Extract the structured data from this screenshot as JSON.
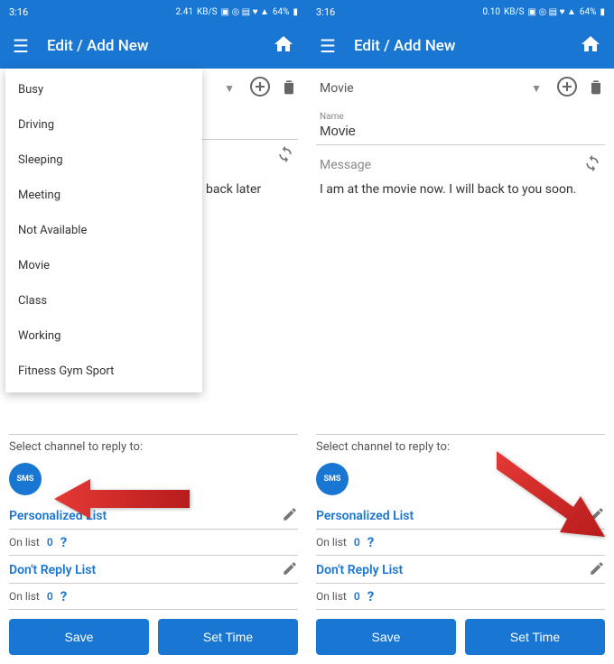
{
  "status": {
    "time": "3:16",
    "net_left": "2.41",
    "net_right": "0.10",
    "unit": "KB/S",
    "battery": "64%"
  },
  "app": {
    "title": "Edit / Add New"
  },
  "left": {
    "dropdown_items": [
      "Busy",
      "Driving",
      "Sleeping",
      "Meeting",
      "Not Available",
      "Movie",
      "Class",
      "Working",
      "Fitness Gym Sport"
    ],
    "peek_text": "back later"
  },
  "right": {
    "selected": "Movie",
    "name_label": "Name",
    "name_value": "Movie",
    "message_label": "Message",
    "message_text": "I am at the movie now. I will back to you soon."
  },
  "bottom": {
    "channel_label": "Select channel to reply to:",
    "sms": "SMS",
    "personalized": "Personalized List",
    "dontreply": "Don't Reply List",
    "onlist": "On list",
    "count": "0",
    "save": "Save",
    "settime": "Set Time"
  }
}
